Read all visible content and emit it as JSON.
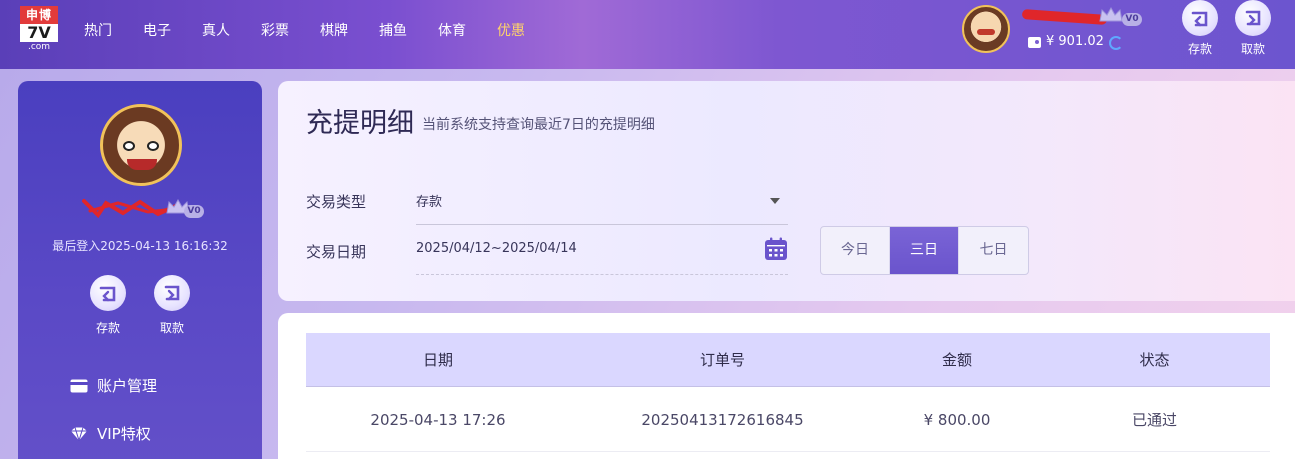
{
  "brand": {
    "logo_top": "申博",
    "logo_mid": "7V",
    "logo_bottom": ".com"
  },
  "nav": [
    {
      "label": "热门"
    },
    {
      "label": "电子"
    },
    {
      "label": "真人"
    },
    {
      "label": "彩票"
    },
    {
      "label": "棋牌"
    },
    {
      "label": "捕鱼"
    },
    {
      "label": "体育"
    },
    {
      "label": "优惠"
    }
  ],
  "header": {
    "vip_level": "V0",
    "balance": "¥ 901.02",
    "deposit_label": "存款",
    "withdraw_label": "取款"
  },
  "sidebar": {
    "vip_level": "V0",
    "last_login": "最后登入2025-04-13 16:16:32",
    "deposit_label": "存款",
    "withdraw_label": "取款",
    "menu": [
      {
        "label": "账户管理",
        "icon": "card-icon"
      },
      {
        "label": "VIP特权",
        "icon": "diamond-icon"
      }
    ]
  },
  "filter": {
    "title": "充提明细",
    "subtitle": "当前系统支持查询最近7日的充提明细",
    "type_label": "交易类型",
    "type_value": "存款",
    "date_label": "交易日期",
    "date_value": "2025/04/12~2025/04/14",
    "ranges": [
      {
        "label": "今日",
        "active": false
      },
      {
        "label": "三日",
        "active": true
      },
      {
        "label": "七日",
        "active": false
      }
    ]
  },
  "table": {
    "columns": [
      "日期",
      "订单号",
      "金额",
      "状态"
    ],
    "rows": [
      {
        "date": "2025-04-13 17:26",
        "order": "20250413172616845",
        "amount": "¥ 800.00",
        "status": "已通过"
      }
    ]
  },
  "colors": {
    "accent": "#6a54cc",
    "highlight_nav": "#ffd36a",
    "table_header": "#dad7ff",
    "redaction": "#e0262a"
  }
}
